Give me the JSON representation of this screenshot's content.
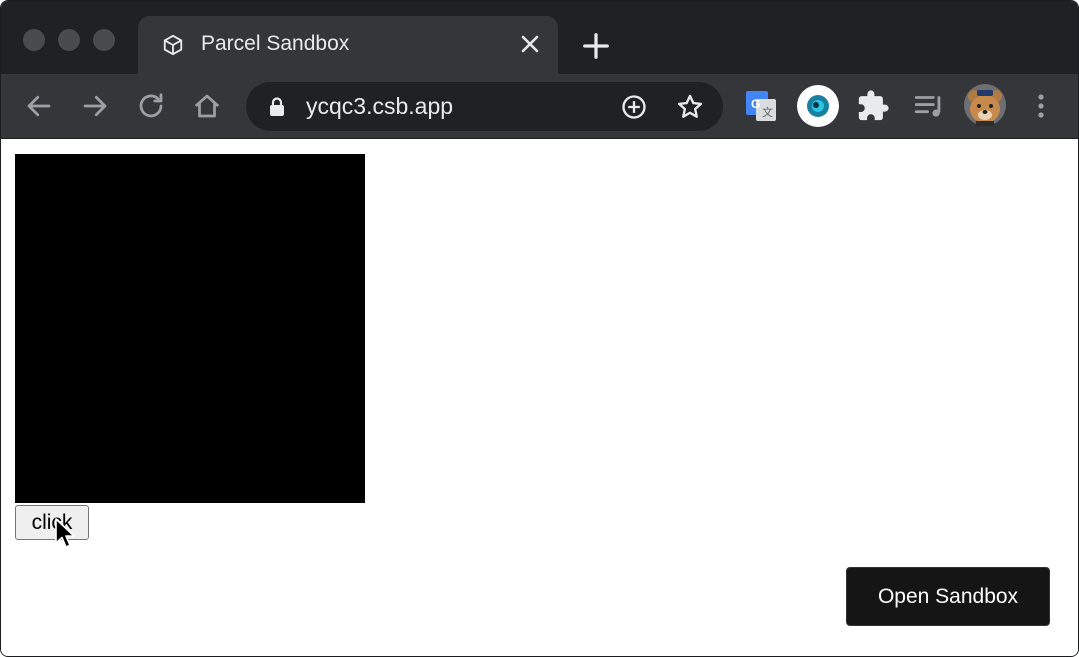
{
  "browser": {
    "tab": {
      "title": "Parcel Sandbox",
      "favicon": "codesandbox-cube-icon"
    },
    "address_bar": {
      "url": "ycqc3.csb.app"
    },
    "extensions": [
      "google-translate-icon",
      "eye-extension-icon",
      "puzzle-extensions-icon",
      "media-playlist-icon",
      "profile-avatar"
    ]
  },
  "page": {
    "click_button_label": "click",
    "open_sandbox_label": "Open Sandbox"
  },
  "colors": {
    "tabstrip": "#202124",
    "toolbar": "#35363a",
    "canvas": "#000000",
    "open_sandbox_bg": "#151515"
  }
}
